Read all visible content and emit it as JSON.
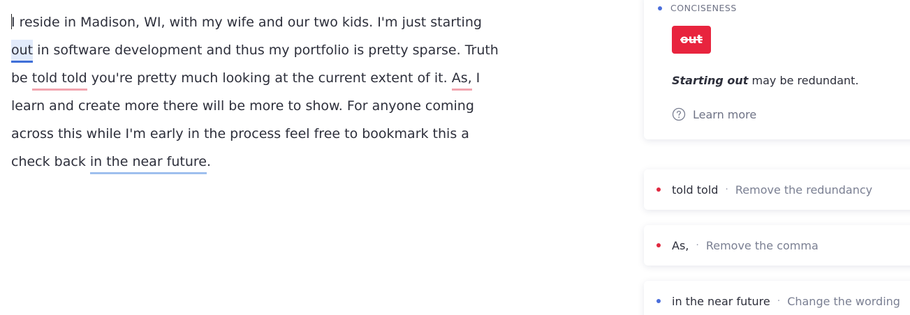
{
  "editor": {
    "line1": "I reside in Madison, WI, with my wife and our two kids. I'm just starting",
    "line2_highlight": "out",
    "line2_rest": " in software development and thus my portfolio is pretty sparse. Truth",
    "line3_before": "be ",
    "line3_hl1": "told told",
    "line3_mid": " you're pretty much looking at the current extent of it. ",
    "line3_hl2": "As,",
    "line3_after": " I",
    "line4": "learn and create more there will be more to show. For anyone coming",
    "line5": "across this while I'm early in the process feel free to bookmark this a",
    "line6_before": "check back ",
    "line6_hl": "in the near future",
    "line6_after": "."
  },
  "suggestion_card": {
    "category": "CONCISENESS",
    "replace_word": "out",
    "explanation_phrase": "Starting out",
    "explanation_rest": " may be redundant.",
    "learn_more": "Learn more",
    "dot_color": "#4a6edb",
    "button_color": "#e8243e"
  },
  "suggestion_list": [
    {
      "title": "told told",
      "separator": "·",
      "description": "Remove the redundancy",
      "dot": "red"
    },
    {
      "title": "As,",
      "separator": "·",
      "description": "Remove the comma",
      "dot": "red"
    },
    {
      "title": "in the near future",
      "separator": "·",
      "description": "Change the wording",
      "dot": "blue"
    }
  ],
  "icons": {
    "help": "question-circle-icon",
    "category_dot": "dot-icon"
  }
}
